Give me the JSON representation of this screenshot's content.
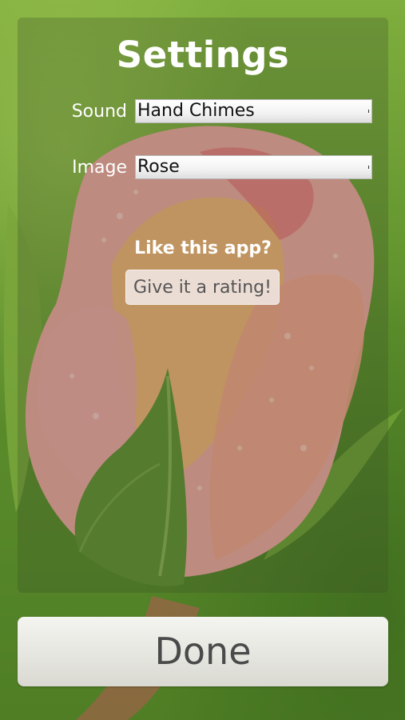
{
  "settings": {
    "title": "Settings",
    "sound": {
      "label": "Sound",
      "value": "Hand Chimes"
    },
    "image": {
      "label": "Image",
      "value": "Rose"
    },
    "rating": {
      "prompt": "Like this app?",
      "button_label": "Give it a rating!"
    }
  },
  "footer": {
    "done_label": "Done"
  },
  "colors": {
    "panel_overlay": "#3c5028",
    "text": "#ffffff",
    "button_bg": "#e6e6e0",
    "button_text": "#4a4a4a"
  },
  "icons": {
    "select_arrow": "dropdown-arrow-icon"
  }
}
